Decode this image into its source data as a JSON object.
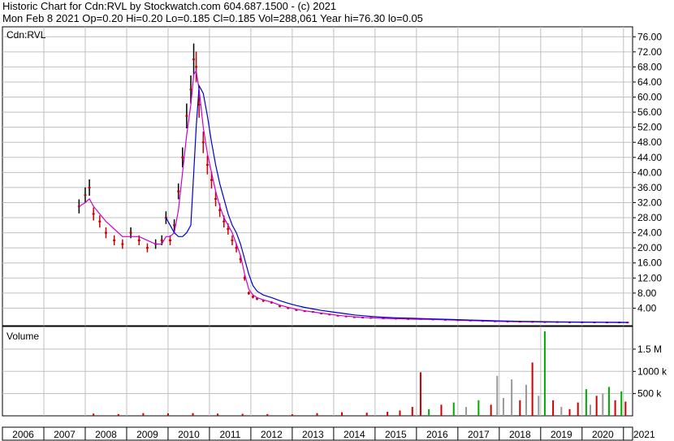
{
  "header": {
    "line1": "Historic Chart for Cdn:RVL by Stockwatch.com 604.687.1500 - (c) 2021",
    "line2": "Mon Feb  8 2021  Op=0.20  Hi=0.20  Lo=0.185  Cl=0.185  Vol=288,061  Year hi=76.30  lo=0.05"
  },
  "chart_data": [
    {
      "type": "line",
      "title": "Cdn:RVL",
      "ylim": [
        0,
        78
      ],
      "y_ticks": [
        "76.00",
        "72.00",
        "68.00",
        "64.00",
        "60.00",
        "56.00",
        "52.00",
        "48.00",
        "44.00",
        "40.00",
        "36.00",
        "32.00",
        "28.00",
        "24.00",
        "20.00",
        "16.00",
        "12.00",
        "8.00",
        "4.00"
      ],
      "x_ticks": [
        "2006",
        "2007",
        "2008",
        "2009",
        "2010",
        "2011",
        "2012",
        "2013",
        "2014",
        "2015",
        "2016",
        "2017",
        "2018",
        "2019",
        "2020",
        "2021"
      ],
      "grid": true,
      "colors": {
        "price": "#000000",
        "down": "#cc0000",
        "ma_short": "#cc00cc",
        "ma_long": "#0000cc",
        "grid": "#c0c0c0"
      },
      "x": [
        2007.85,
        2008.0,
        2008.1,
        2008.2,
        2008.35,
        2008.5,
        2008.7,
        2008.9,
        2009.1,
        2009.3,
        2009.5,
        2009.7,
        2009.85,
        2009.95,
        2010.05,
        2010.15,
        2010.25,
        2010.35,
        2010.45,
        2010.55,
        2010.62,
        2010.68,
        2010.75,
        2010.85,
        2010.95,
        2011.05,
        2011.15,
        2011.25,
        2011.35,
        2011.45,
        2011.55,
        2011.65,
        2011.75,
        2011.85,
        2011.95,
        2012.05,
        2012.15,
        2012.3,
        2012.5,
        2012.7,
        2012.9,
        2013.1,
        2013.3,
        2013.5,
        2013.7,
        2013.9,
        2014.1,
        2014.3,
        2014.5,
        2014.7,
        2014.9,
        2015.2,
        2015.5,
        2015.8,
        2016.1,
        2016.4,
        2016.7,
        2017.0,
        2017.3,
        2017.6,
        2017.9,
        2018.2,
        2018.5,
        2018.8,
        2019.1,
        2019.4,
        2019.7,
        2020.0,
        2020.3,
        2020.6,
        2020.9,
        2021.1
      ],
      "series": [
        {
          "values": [
            31,
            34,
            36,
            29,
            27,
            24,
            22,
            21,
            24,
            22,
            20,
            21,
            22,
            28,
            22,
            26,
            35,
            44,
            55,
            62,
            70,
            68,
            58,
            48,
            42,
            38,
            33,
            30,
            27,
            25,
            22,
            20,
            17,
            12,
            8,
            7,
            6.5,
            6,
            5.5,
            4.5,
            4,
            3.5,
            3.2,
            3,
            2.6,
            2.3,
            2,
            1.8,
            1.6,
            1.5,
            1.4,
            1.3,
            1.2,
            1.1,
            1.1,
            1.0,
            0.9,
            0.8,
            0.7,
            0.6,
            0.5,
            0.45,
            0.4,
            0.35,
            0.3,
            0.3,
            0.25,
            0.25,
            0.22,
            0.2,
            0.2,
            0.185
          ]
        },
        {
          "values": [
            31,
            32,
            33,
            31,
            29,
            27,
            25,
            23,
            23,
            23,
            22,
            21,
            21,
            23,
            23,
            24,
            30,
            40,
            50,
            58,
            66,
            67,
            62,
            52,
            45,
            40,
            35,
            31,
            28,
            26,
            24,
            21,
            18,
            13,
            9,
            7.5,
            6.8,
            6.2,
            5.6,
            4.8,
            4.2,
            3.7,
            3.3,
            3.0,
            2.7,
            2.4,
            2.1,
            1.9,
            1.7,
            1.55,
            1.45,
            1.3,
            1.2,
            1.1,
            1.05,
            1.0,
            0.9,
            0.8,
            0.7,
            0.6,
            0.52,
            0.46,
            0.41,
            0.36,
            0.32,
            0.3,
            0.27,
            0.25,
            0.23,
            0.21,
            0.2,
            0.19
          ]
        },
        {
          "values": [
            null,
            null,
            null,
            null,
            null,
            null,
            null,
            null,
            null,
            null,
            null,
            null,
            null,
            28,
            26,
            24,
            23,
            23,
            24,
            26,
            40,
            52,
            63,
            61,
            55,
            48,
            42,
            37,
            33,
            29,
            26,
            24,
            21,
            17,
            13,
            10,
            8.5,
            7.5,
            6.8,
            6,
            5.3,
            4.7,
            4.2,
            3.8,
            3.4,
            3.1,
            2.8,
            2.5,
            2.2,
            2.0,
            1.8,
            1.6,
            1.45,
            1.35,
            1.25,
            1.15,
            1.05,
            0.95,
            0.85,
            0.75,
            0.65,
            0.58,
            0.5,
            0.45,
            0.4,
            0.36,
            0.32,
            0.3,
            0.27,
            0.25,
            0.23,
            0.21
          ]
        }
      ]
    },
    {
      "type": "bar",
      "title": "Volume",
      "ylim": [
        0,
        1900000
      ],
      "y_ticks": [
        "1.5 M",
        "1000 k",
        "500 k"
      ],
      "colors": {
        "up": "#00aa00",
        "down": "#cc0000",
        "flat": "#999999"
      },
      "x": [
        2008.2,
        2008.8,
        2009.4,
        2010.0,
        2010.6,
        2011.2,
        2011.8,
        2012.4,
        2013.0,
        2013.6,
        2014.2,
        2014.8,
        2015.3,
        2015.6,
        2015.9,
        2016.1,
        2016.3,
        2016.6,
        2016.9,
        2017.2,
        2017.5,
        2017.8,
        2017.95,
        2018.1,
        2018.3,
        2018.5,
        2018.65,
        2018.8,
        2018.95,
        2019.1,
        2019.3,
        2019.5,
        2019.7,
        2019.9,
        2020.1,
        2020.2,
        2020.35,
        2020.5,
        2020.65,
        2020.8,
        2020.95,
        2021.05
      ],
      "values": [
        50000,
        40000,
        60000,
        55000,
        60000,
        50000,
        45000,
        40000,
        35000,
        60000,
        80000,
        70000,
        90000,
        120000,
        200000,
        980000,
        150000,
        250000,
        300000,
        200000,
        350000,
        250000,
        900000,
        400000,
        820000,
        350000,
        700000,
        1200000,
        450000,
        1900000,
        350000,
        200000,
        150000,
        300000,
        600000,
        250000,
        450000,
        500000,
        650000,
        350000,
        550000,
        320000
      ],
      "direction": [
        "down",
        "down",
        "down",
        "down",
        "down",
        "down",
        "down",
        "down",
        "down",
        "down",
        "down",
        "down",
        "down",
        "down",
        "down",
        "down",
        "up",
        "down",
        "up",
        "flat",
        "up",
        "down",
        "flat",
        "flat",
        "flat",
        "down",
        "flat",
        "down",
        "flat",
        "up",
        "down",
        "flat",
        "down",
        "down",
        "up",
        "flat",
        "down",
        "flat",
        "up",
        "down",
        "up",
        "down"
      ]
    }
  ]
}
